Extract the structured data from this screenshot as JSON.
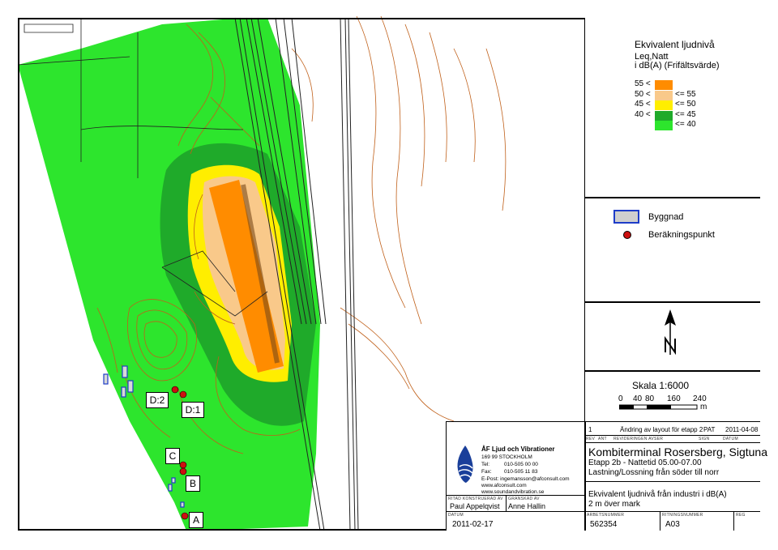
{
  "legend": {
    "title1": "Ekvivalent ljudnivå",
    "title2": "Leq,Natt",
    "title3": "i dB(A) (Frifältsvärde)",
    "rows": [
      {
        "left": "55 <",
        "right": "",
        "color": "#ff8c00"
      },
      {
        "left": "50 <",
        "right": "<= 55",
        "color": "#f9c98a"
      },
      {
        "left": "45 <",
        "right": "<= 50",
        "color": "#ffee00"
      },
      {
        "left": "40 <",
        "right": "<= 45",
        "color": "#1faa2a"
      },
      {
        "left": "",
        "right": "<= 40",
        "color": "#2de52d"
      }
    ],
    "building_label": "Byggnad",
    "point_label": "Beräkningspunkt"
  },
  "north_label": "N",
  "scale": {
    "title": "Skala 1:6000",
    "ticks": [
      "0",
      "40",
      "80",
      "160",
      "240"
    ],
    "unit": "m"
  },
  "revision": {
    "num": "1",
    "text": "Ändring av layout för etapp 2",
    "sign": "PAT",
    "date": "2011-04-08",
    "headers": [
      "REV",
      "ANT",
      "REVIDERINGEN AVSER",
      "SIGN",
      "DATUM"
    ]
  },
  "company": {
    "name": "ÅF Ljud och Vibrationer",
    "address": "169 99 STOCKHOLM",
    "tel_label": "Tel:",
    "tel": "010-505 00 00",
    "fax_label": "Fax:",
    "fax": "010-505 11 83",
    "email": "E-Post: ingemansson@afconsult.com",
    "web1": "www.afconsult.com",
    "web2": "www.soundandvibration.se"
  },
  "title_block": {
    "project": "Kombiterminal Rosersberg, Sigtuna",
    "stage": "Etapp 2b - Nattetid 05.00-07.00",
    "scenario": "Lastning/Lossning från söder till norr",
    "content1": "Ekvivalent ljudnivå från industri i dB(A)",
    "content2": "2 m över mark",
    "drawn_label": "RITAD KONSTRUERAD AV",
    "drawn_by": "Paul Appelqvist",
    "checked_label": "GRANSKAD AV",
    "checked_by": "Anne Hallin",
    "date_label": "DATUM",
    "date": "2011-02-17",
    "job_label": "ARBETSNUMMER",
    "job": "562354",
    "drawing_label": "RITNINGSNUMMER",
    "drawing": "A03",
    "reg_label": "REG"
  },
  "map_labels": {
    "d2": "D:2",
    "d1": "D:1",
    "c": "C",
    "b": "B",
    "a": "A"
  }
}
